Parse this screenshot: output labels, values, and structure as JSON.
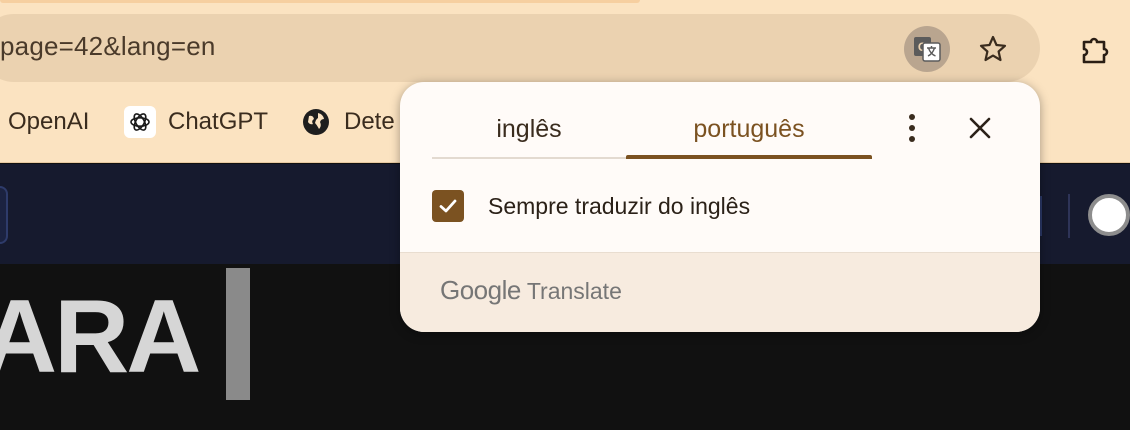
{
  "browser": {
    "url": "page=42&lang=en",
    "toolbar_icons": [
      "translate-icon",
      "star-icon",
      "extension-icon"
    ]
  },
  "bookmarks": [
    {
      "label": "OpenAI",
      "icon": "none"
    },
    {
      "label": "ChatGPT",
      "icon": "openai-logo-icon"
    },
    {
      "label": "Dete",
      "icon": "globe-icon"
    }
  ],
  "page": {
    "hero_text": "ARA"
  },
  "translate_popup": {
    "source_tab": "inglês",
    "target_tab": "português",
    "selected_tab": "português",
    "always_translate_label": "Sempre traduzir do inglês",
    "always_translate_checked": true,
    "brand_google": "Google",
    "brand_translate": "Translate"
  },
  "colors": {
    "chrome_bg": "#fbe3c1",
    "omnibox_bg": "#ebd2b0",
    "accent": "#7b5221",
    "popup_bg": "#fffbf8",
    "popup_footer_bg": "#f7ebdf",
    "page_nav_bg": "#161a2e",
    "page_bg": "#111111"
  }
}
